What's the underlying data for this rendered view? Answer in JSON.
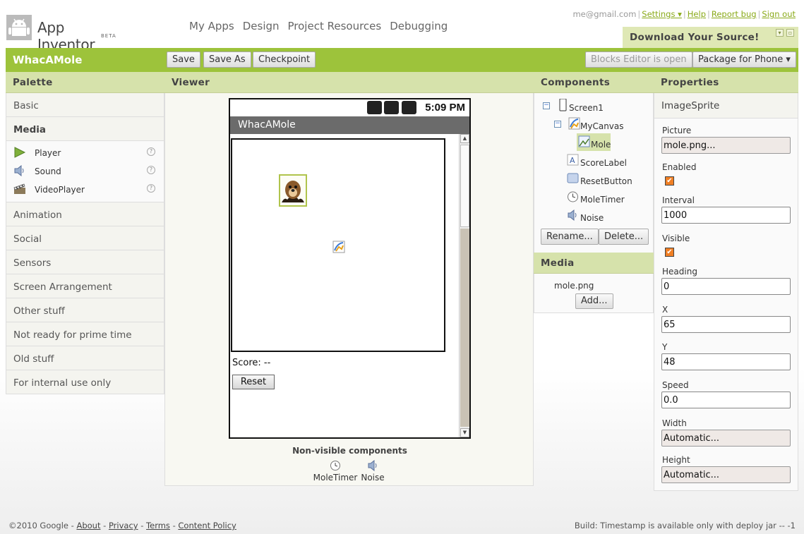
{
  "header": {
    "logo_title": "App Inventor",
    "logo_beta": "BETA",
    "nav": [
      "My Apps",
      "Design",
      "Project Resources",
      "Debugging"
    ],
    "user_email": "me@gmail.com",
    "settings_label": "Settings ▾",
    "help_label": "Help",
    "report_bug_label": "Report bug",
    "sign_out_label": "Sign out",
    "download_source_label": "Download Your Source!"
  },
  "project_bar": {
    "project_name": "WhacAMole",
    "save_label": "Save",
    "save_as_label": "Save As",
    "checkpoint_label": "Checkpoint",
    "blocks_editor_label": "Blocks Editor is open",
    "package_label": "Package for Phone ▾"
  },
  "palette": {
    "title": "Palette",
    "categories_before": [
      "Basic"
    ],
    "open_category": "Media",
    "media_items": [
      {
        "label": "Player",
        "icon": "play-icon"
      },
      {
        "label": "Sound",
        "icon": "speaker-icon"
      },
      {
        "label": "VideoPlayer",
        "icon": "clapperboard-icon"
      }
    ],
    "help_glyph": "?",
    "categories_after": [
      "Animation",
      "Social",
      "Sensors",
      "Screen Arrangement",
      "Other stuff",
      "Not ready for prime time",
      "Old stuff",
      "For internal use only"
    ]
  },
  "viewer": {
    "title": "Viewer",
    "phone_time": "5:09 PM",
    "app_title": "WhacAMole",
    "score_text": "Score: --",
    "reset_label": "Reset",
    "nonvisible_title": "Non-visible components",
    "nonvisible": [
      {
        "label": "MoleTimer",
        "icon": "clock-icon"
      },
      {
        "label": "Noise",
        "icon": "speaker-icon"
      }
    ]
  },
  "components": {
    "title": "Components",
    "tree": [
      {
        "label": "Screen1",
        "icon": "phone-icon",
        "toggle": "−"
      },
      {
        "label": "MyCanvas",
        "icon": "canvas-icon",
        "toggle": "−"
      },
      {
        "label": "Mole",
        "icon": "image-sprite-icon",
        "selected": true
      },
      {
        "label": "ScoreLabel",
        "icon": "label-icon"
      },
      {
        "label": "ResetButton",
        "icon": "button-icon"
      },
      {
        "label": "MoleTimer",
        "icon": "clock-icon"
      },
      {
        "label": "Noise",
        "icon": "speaker-icon"
      }
    ],
    "rename_label": "Rename...",
    "delete_label": "Delete..."
  },
  "media": {
    "title": "Media",
    "files": [
      "mole.png"
    ],
    "add_label": "Add..."
  },
  "properties": {
    "title": "Properties",
    "component_type": "ImageSprite",
    "picture_label": "Picture",
    "picture_value": "mole.png...",
    "enabled_label": "Enabled",
    "enabled_checked": true,
    "interval_label": "Interval",
    "interval_value": "1000",
    "visible_label": "Visible",
    "visible_checked": true,
    "heading_label": "Heading",
    "heading_value": "0",
    "x_label": "X",
    "x_value": "65",
    "y_label": "Y",
    "y_value": "48",
    "speed_label": "Speed",
    "speed_value": "0.0",
    "width_label": "Width",
    "width_value": "Automatic...",
    "height_label": "Height",
    "height_value": "Automatic...",
    "check_glyph": "✔"
  },
  "footer": {
    "copyright": "©2010 Google",
    "links": [
      "About",
      "Privacy",
      "Terms",
      "Content Policy"
    ],
    "build_text": "Build: Timestamp is available only with deploy jar -- -1"
  },
  "colors": {
    "accent_green": "#9dc33b",
    "panel_header": "#d6e2ab",
    "link_green": "#8aaa1a",
    "checkbox_orange": "#f07f24"
  }
}
